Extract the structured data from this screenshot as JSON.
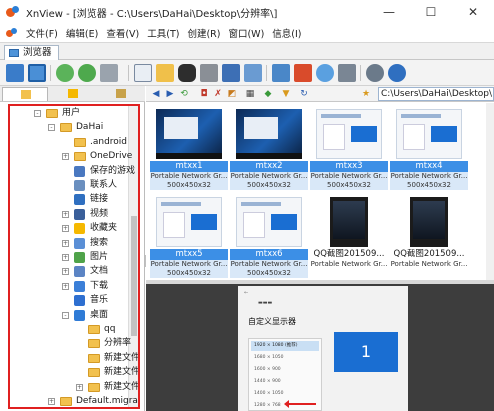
{
  "window": {
    "title": "XnView - [浏览器 - C:\\Users\\DaHai\\Desktop\\分辨率\\]",
    "controls": {
      "minimize": "—",
      "maximize": "☐",
      "close": "✕"
    }
  },
  "menu": [
    "文件(F)",
    "编辑(E)",
    "查看(V)",
    "工具(T)",
    "创建(R)",
    "窗口(W)",
    "信息(I)"
  ],
  "tab": {
    "label": "浏览器"
  },
  "path": "C:\\Users\\DaHai\\Desktop\\",
  "tree": [
    {
      "label": "用户",
      "level": 0,
      "exp": "-",
      "kind": "folder"
    },
    {
      "label": "DaHai",
      "level": 1,
      "exp": "-",
      "kind": "folder"
    },
    {
      "label": ".android",
      "level": 2,
      "exp": "",
      "kind": "folder"
    },
    {
      "label": "OneDrive",
      "level": 2,
      "exp": "+",
      "kind": "folder"
    },
    {
      "label": "保存的游戏",
      "level": 2,
      "exp": "",
      "kind": "game"
    },
    {
      "label": "联系人",
      "level": 2,
      "exp": "",
      "kind": "contact"
    },
    {
      "label": "链接",
      "level": 2,
      "exp": "",
      "kind": "link"
    },
    {
      "label": "视频",
      "level": 2,
      "exp": "+",
      "kind": "video"
    },
    {
      "label": "收藏夹",
      "level": 2,
      "exp": "+",
      "kind": "star"
    },
    {
      "label": "搜索",
      "level": 2,
      "exp": "+",
      "kind": "search"
    },
    {
      "label": "图片",
      "level": 2,
      "exp": "+",
      "kind": "image"
    },
    {
      "label": "文档",
      "level": 2,
      "exp": "+",
      "kind": "doc"
    },
    {
      "label": "下载",
      "level": 2,
      "exp": "+",
      "kind": "download"
    },
    {
      "label": "音乐",
      "level": 2,
      "exp": "",
      "kind": "music"
    },
    {
      "label": "桌面",
      "level": 2,
      "exp": "-",
      "kind": "desktop"
    },
    {
      "label": "qq",
      "level": 3,
      "exp": "",
      "kind": "folder"
    },
    {
      "label": "分辨率",
      "level": 3,
      "exp": "",
      "kind": "folder"
    },
    {
      "label": "新建文件",
      "level": 3,
      "exp": "",
      "kind": "folder"
    },
    {
      "label": "新建文件",
      "level": 3,
      "exp": "",
      "kind": "folder"
    },
    {
      "label": "新建文件",
      "level": 3,
      "exp": "+",
      "kind": "folder"
    },
    {
      "label": "Default.migrat",
      "level": 1,
      "exp": "+",
      "kind": "folder"
    }
  ],
  "thumbnails": [
    {
      "name": "mtxx1",
      "type": "Portable Network Gr...",
      "size": "500x450x32",
      "selected": true,
      "style": "dark"
    },
    {
      "name": "mtxx2",
      "type": "Portable Network Gr...",
      "size": "500x450x32",
      "selected": true,
      "style": "dark"
    },
    {
      "name": "mtxx3",
      "type": "Portable Network Gr...",
      "size": "500x450x32",
      "selected": true,
      "style": "light"
    },
    {
      "name": "mtxx4",
      "type": "Portable Network Gr...",
      "size": "500x450x32",
      "selected": true,
      "style": "light"
    },
    {
      "name": "mtxx5",
      "type": "Portable Network Gr...",
      "size": "500x450x32",
      "selected": true,
      "style": "light"
    },
    {
      "name": "mtxx6",
      "type": "Portable Network Gr...",
      "size": "500x450x32",
      "selected": true,
      "style": "light"
    },
    {
      "name": "QQ截图201509...",
      "type": "Portable Network Gr...",
      "size": "",
      "selected": false,
      "style": "phone"
    },
    {
      "name": "QQ截图201509...",
      "type": "Portable Network Gr...",
      "size": "",
      "selected": false,
      "style": "phone"
    }
  ],
  "preview": {
    "title": "自定义显示器",
    "options": [
      "1920 × 1080 (推荐)",
      "1680 × 1050",
      "1600 × 900",
      "1440 × 900",
      "1400 × 1050",
      "1280 × 768"
    ],
    "monitor_label": "1"
  }
}
